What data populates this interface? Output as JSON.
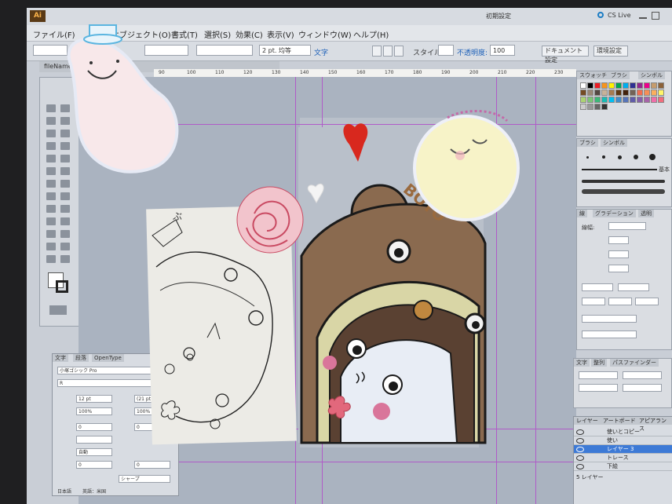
{
  "app": {
    "logo": "Ai",
    "workspace": "初期設定",
    "search_label": "CS Live"
  },
  "menu": [
    "ファイル(F)",
    "オブジェクト(O)",
    "書式(T)",
    "選択(S)",
    "効果(C)",
    "表示(V)",
    "ウィンドウ(W)",
    "ヘルプ(H)"
  ],
  "control_bar": {
    "stroke_weight": "2 pt. 均等",
    "style_label": "スタイル:",
    "opacity_label": "不透明度:",
    "opacity_value": "100",
    "doc_setup_button": "ドキュメント設定",
    "prefs_button": "環境設定",
    "type_label": "文字"
  },
  "document_tab": "fileName.ai",
  "ruler_ticks": [
    "90",
    "100",
    "110",
    "120",
    "130",
    "140",
    "150",
    "160",
    "170",
    "180",
    "190",
    "200",
    "210",
    "220",
    "230"
  ],
  "panels": {
    "swatch_tabs": [
      "スウォッチ",
      "ブラシ",
      "シンボル"
    ],
    "brush_tabs": [
      "ブラシ",
      "シンボル"
    ],
    "stroke_label": "基本",
    "transform_tabs": [
      "線",
      "グラデーション",
      "透明"
    ],
    "stroke_weight_label": "線幅:",
    "char_tabs": [
      "文字",
      "段落",
      "OpenType"
    ],
    "char_font": "小塚ゴシック Pro",
    "char_style": "R",
    "char_size": "12 pt",
    "char_leading": "(21 pt)",
    "char_tracking": "100%",
    "char_kerning": "100%",
    "char_auto": "自動",
    "char_zero": "0",
    "char_aa": "シャープ",
    "char_lang": "日本語",
    "char_lang2": "英語：米国",
    "align_tabs": [
      "文字",
      "整列",
      "パスファインダー"
    ],
    "layers_tabs": [
      "レイヤー",
      "アートボード",
      "アピアランス"
    ],
    "layers": [
      "使いとコピー",
      "使い",
      "レイヤー 3",
      "トレース",
      "下絵"
    ],
    "layers_count": "5 レイヤー"
  },
  "canvas_text": {
    "brand": "BOTO"
  },
  "colors": {
    "screen_bg": "#c9ced6",
    "canvas_bg": "#aab3c0",
    "guide": "#b05bc8",
    "bear_brown": "#8a6a4f",
    "hood_cream": "#d9d6a6",
    "heart_red": "#d8281e",
    "active_layer": "#3d7ad6"
  },
  "stickers": [
    "bean-sticker",
    "flower-crown-blob-sticker",
    "rose-sticker",
    "red-heart-sticker",
    "white-heart-sticker"
  ]
}
